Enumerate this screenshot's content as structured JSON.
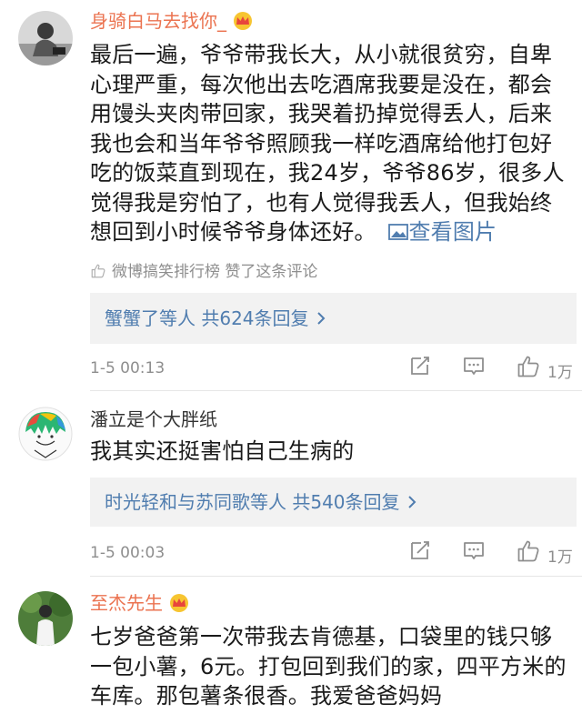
{
  "comments": [
    {
      "username": "身骑白马去找你_",
      "vip": true,
      "text": "最后一遍，爷爷带我长大，从小就很贫穷，自卑心理严重，每次他出去吃酒席我要是没在，都会用馒头夹肉带回家，我哭着扔掉觉得丢人，后来我也会和当年爷爷照顾我一样吃酒席给他打包好吃的饭菜直到现在，我24岁，爷爷86岁，很多人觉得我是穷怕了，也有人觉得我丢人，但我始终想回到小时候爷爷身体还好。",
      "view_pic": "查看图片",
      "liked_by": "微博搞笑排行榜 赞了这条评论",
      "reply_summary": "蟹蟹了等人 共624条回复",
      "time": "1-5 00:13",
      "likes": "1万"
    },
    {
      "username": "潘立是个大胖纸",
      "vip": false,
      "text": "我其实还挺害怕自己生病的",
      "reply_summary": "时光轻和与苏同歌等人 共540条回复",
      "time": "1-5 00:03",
      "likes": "1万"
    },
    {
      "username": "至杰先生",
      "vip": true,
      "text": "七岁爸爸第一次带我去肯德基，口袋里的钱只够一包小薯，6元。打包回到我们的家，四平方米的车库。那包薯条很香。我爱爸爸妈妈"
    }
  ],
  "colors": {
    "vip_name": "#eb7350",
    "link": "#507daf",
    "meta": "#8e8e8e",
    "reply_bg": "#f2f2f2"
  },
  "icons": [
    "crown-icon",
    "picture-icon",
    "thumb-up-icon",
    "repost-icon",
    "comment-icon",
    "chevron-right-icon"
  ]
}
